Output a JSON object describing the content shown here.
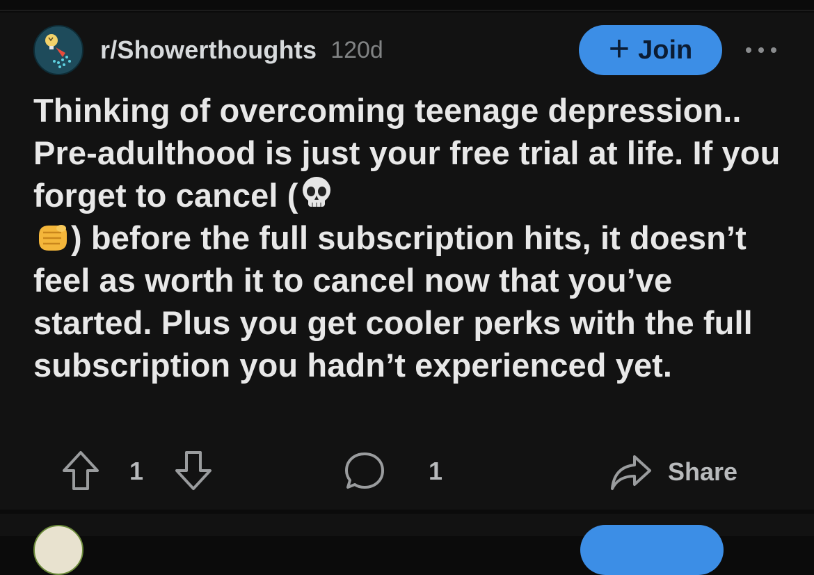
{
  "post": {
    "subreddit": "r/Showerthoughts",
    "age": "120d",
    "join_label": "Join",
    "join_plus": "+",
    "title_parts": [
      "Thinking of overcoming teenage depression.. Pre-adulthood is just your free trial at life. If you forget to cancel (",
      ") before the full subscription hits, it doesn’t feel as worth it to cancel now that you’ve started. Plus you get cooler perks with the full subscription you hadn’t experienced yet."
    ],
    "emojis": [
      "skull-emoji",
      "fist-emoji"
    ],
    "upvote_count": "1",
    "comment_count": "1",
    "share_label": "Share"
  },
  "colors": {
    "background": "#121212",
    "accent": "#3c8ee6",
    "muted_text": "#818384"
  }
}
